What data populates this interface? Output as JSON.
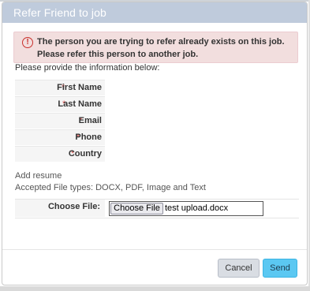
{
  "dialog": {
    "title": "Refer Friend to job"
  },
  "alert": {
    "icon": "exclamation-circle-icon",
    "color": "#c9302c",
    "message": "The person you are trying to refer already exists on this job. Please refer this person to another job."
  },
  "form": {
    "instructions": "Please provide the information below:",
    "required_mark": "*",
    "fields": [
      {
        "label": "First Name",
        "required": true
      },
      {
        "label": "Last Name",
        "required": true
      },
      {
        "label": "Email",
        "required": true
      },
      {
        "label": "Phone",
        "required": true
      },
      {
        "label": "Country",
        "required": true
      }
    ]
  },
  "resume": {
    "title": "Add resume",
    "accepted_types": "Accepted File types: DOCX, PDF, Image and Text",
    "file_label": "Choose File:",
    "choose_button": "Choose File",
    "file_name": "test upload.docx"
  },
  "footer": {
    "cancel_label": "Cancel",
    "send_label": "Send",
    "send_color": "#5bc8f2"
  }
}
